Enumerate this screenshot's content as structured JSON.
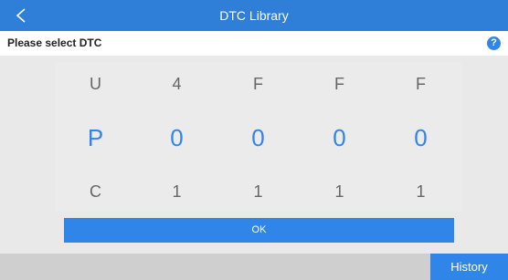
{
  "header": {
    "title": "DTC Library",
    "back_icon": "chevron-left-icon"
  },
  "subheader": {
    "label": "Please select DTC",
    "help_icon": "?"
  },
  "picker": {
    "columns": [
      {
        "above": "U",
        "selected": "P",
        "below": "C"
      },
      {
        "above": "4",
        "selected": "0",
        "below": "1"
      },
      {
        "above": "F",
        "selected": "0",
        "below": "1"
      },
      {
        "above": "F",
        "selected": "0",
        "below": "1"
      },
      {
        "above": "F",
        "selected": "0",
        "below": "1"
      }
    ],
    "selected_color": "#2f86e8"
  },
  "actions": {
    "ok_label": "OK",
    "history_label": "History"
  },
  "colors": {
    "accent": "#2f7ed8",
    "button": "#2f86e8"
  }
}
